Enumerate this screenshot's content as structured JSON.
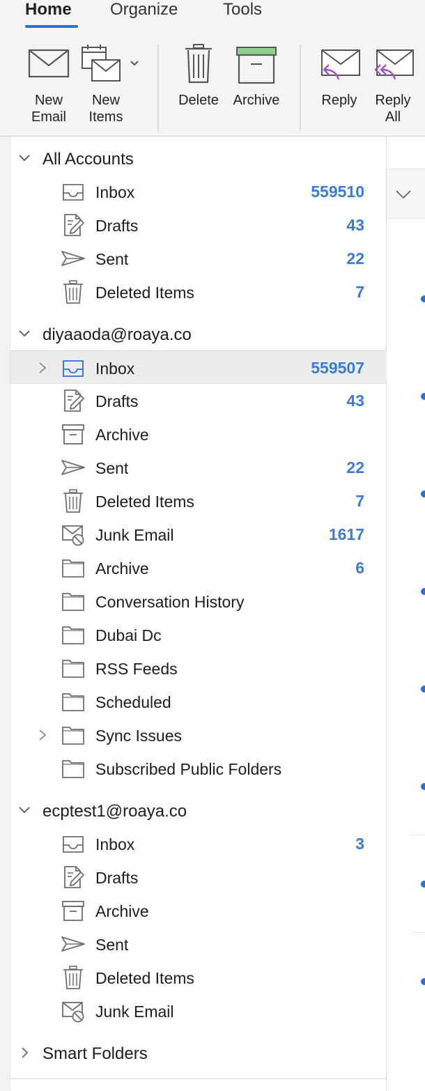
{
  "ribbon": {
    "tabs": [
      {
        "label": "Home",
        "active": true
      },
      {
        "label": "Organize",
        "active": false
      },
      {
        "label": "Tools",
        "active": false
      }
    ],
    "buttons": {
      "new_email": "New\nEmail",
      "new_items": "New\nItems",
      "delete": "Delete",
      "archive": "Archive",
      "reply": "Reply",
      "reply_all": "Reply\nAll"
    }
  },
  "accounts": [
    {
      "name": "All Accounts",
      "folders": [
        {
          "label": "Inbox",
          "count": "559510",
          "icon": "inbox-icon"
        },
        {
          "label": "Drafts",
          "count": "43",
          "icon": "drafts-icon"
        },
        {
          "label": "Sent",
          "count": "22",
          "icon": "sent-icon"
        },
        {
          "label": "Deleted Items",
          "count": "7",
          "icon": "trash-icon"
        }
      ]
    },
    {
      "name": "diyaaoda@roaya.co",
      "folders": [
        {
          "label": "Inbox",
          "count": "559507",
          "icon": "inbox-icon",
          "selected": true
        },
        {
          "label": "Drafts",
          "count": "43",
          "icon": "drafts-icon"
        },
        {
          "label": "Archive",
          "count": "",
          "icon": "archive-box-icon"
        },
        {
          "label": "Sent",
          "count": "22",
          "icon": "sent-icon"
        },
        {
          "label": "Deleted Items",
          "count": "7",
          "icon": "trash-icon"
        },
        {
          "label": "Junk Email",
          "count": "1617",
          "icon": "junk-icon"
        },
        {
          "label": "Archive",
          "count": "6",
          "icon": "folder-icon"
        },
        {
          "label": "Conversation History",
          "count": "",
          "icon": "folder-icon"
        },
        {
          "label": "Dubai Dc",
          "count": "",
          "icon": "folder-icon"
        },
        {
          "label": "RSS Feeds",
          "count": "",
          "icon": "folder-icon"
        },
        {
          "label": "Scheduled",
          "count": "",
          "icon": "folder-icon"
        },
        {
          "label": "Sync Issues",
          "count": "",
          "icon": "folder-icon"
        },
        {
          "label": "Subscribed Public Folders",
          "count": "",
          "icon": "folder-icon"
        }
      ]
    },
    {
      "name": "ecptest1@roaya.co",
      "folders": [
        {
          "label": "Inbox",
          "count": "3",
          "icon": "inbox-icon"
        },
        {
          "label": "Drafts",
          "count": "",
          "icon": "drafts-icon"
        },
        {
          "label": "Archive",
          "count": "",
          "icon": "archive-box-icon"
        },
        {
          "label": "Sent",
          "count": "",
          "icon": "sent-icon"
        },
        {
          "label": "Deleted Items",
          "count": "",
          "icon": "trash-icon"
        },
        {
          "label": "Junk Email",
          "count": "",
          "icon": "junk-icon"
        }
      ]
    },
    {
      "name": "Smart Folders",
      "folders": []
    }
  ],
  "colors": {
    "accent": "#2b6fd1",
    "count": "#3a7bd5",
    "reply_arrow": "#a54fc4",
    "archive_lid": "#8fd08f"
  }
}
